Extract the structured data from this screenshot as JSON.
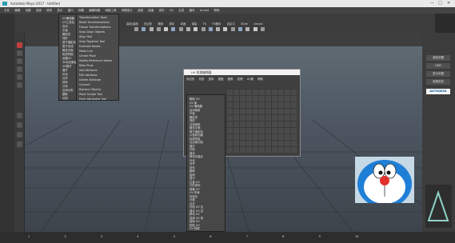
{
  "titlebar": {
    "title": "Autodesk Maya 2017 · Untitled",
    "min": "—",
    "max": "□",
    "close": "✕"
  },
  "menubar": {
    "items": [
      "文件",
      "编辑",
      "创建",
      "选择",
      "修改",
      "显示",
      "窗口",
      "网格",
      "编辑网格",
      "网格工具",
      "网格显示",
      "曲线",
      "曲面",
      "变形",
      "UV",
      "生成",
      "缓存",
      "Arnold",
      "帮助"
    ]
  },
  "shelf": {
    "tabs": [
      "曲线/曲面",
      "多边形",
      "雕刻",
      "绑定",
      "动画",
      "渲染",
      "FX",
      "FX缓存",
      "自定义",
      "XGen",
      "Arnold"
    ]
  },
  "menu1": {
    "items": [
      "UV编辑器",
      "UV工具包",
      "自动",
      "平面",
      "圆柱形",
      "球形",
      "基于摄影机",
      "基于法线",
      "最佳平面",
      "轮廓拼接",
      "创建UV",
      "3D切割和缝合UV工具",
      "2D展开",
      "展开",
      "优化",
      "对齐",
      "排布",
      "分布",
      "空间分布",
      "翻转",
      "切割",
      "缝合"
    ]
  },
  "menu2": {
    "items": [
      "Transformation Tools",
      "Reset Transformations",
      "Freeze Transformations",
      "Snap Align Objects",
      "Align Tool",
      "Snap Together Tool",
      "Evaluate Nodes",
      "Make Live",
      "Center Pivot",
      "Modify Reference Nodes",
      "Bake Pivot",
      "Add Attribute",
      "Edit Attribute",
      "Delete Attribute",
      "Convert",
      "Replace Objects",
      "Paint Scripts Tool",
      "Paint Attributes Tool"
    ]
  },
  "uv_editor": {
    "title": "UV 纹理编辑器",
    "menus": [
      "多边形",
      "切割",
      "选择",
      "视图",
      "图像",
      "纹理",
      "UV集",
      "帮助"
    ]
  },
  "uv_menu": {
    "items": [
      "删除 UV",
      "UV 集",
      "UV 编辑器",
      "自动映射",
      "平面",
      "圆柱形",
      "球形",
      "法线映射",
      "最佳平面",
      "基于摄影机",
      "从投影创建",
      "轮廓拼接",
      "沿边缘切割",
      "展开",
      "切割",
      "缝合",
      "移动并缝合",
      "优化",
      "对齐",
      "排布",
      "翻转",
      "旋转",
      "居中",
      "拉直 UV",
      "方形排布",
      "网格 UV",
      "UV 布局",
      "标准化",
      "分离",
      "合并",
      "切割 UV 边",
      "缝合 UV 边",
      "移动 UV",
      "选择 UV 壳",
      "复制 UV",
      "粘贴 UV",
      "UV 快照"
    ]
  },
  "rightpanel": {
    "buttons": [
      "渲染设置",
      "HDR",
      "AUTODESK",
      "显示设置",
      "资源浏览"
    ]
  },
  "bottom": {
    "items": [
      "1",
      "2",
      "3",
      "4",
      "5",
      "6",
      "7",
      "8",
      "9",
      "10"
    ]
  }
}
